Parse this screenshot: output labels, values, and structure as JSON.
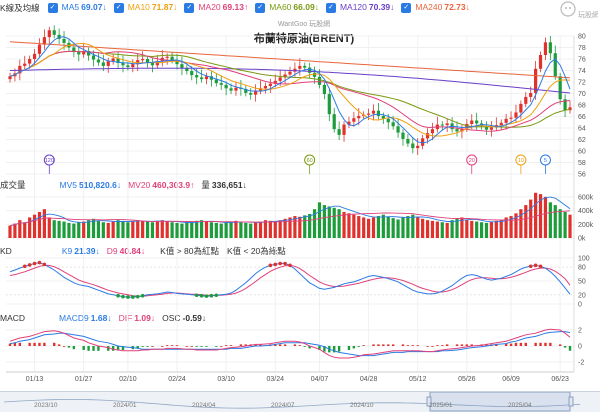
{
  "legend_main": {
    "label": "K線及均線",
    "items": [
      {
        "key": "MA5",
        "value": "69.07",
        "arrow": "↓",
        "color": "#2b7be4"
      },
      {
        "key": "MA10",
        "value": "71.87",
        "arrow": "↓",
        "color": "#f0a010"
      },
      {
        "key": "MA20",
        "value": "69.13",
        "arrow": "↑",
        "color": "#e0407a"
      },
      {
        "key": "MA60",
        "value": "66.09",
        "arrow": "↓",
        "color": "#7a9a10"
      },
      {
        "key": "MA120",
        "value": "70.39",
        "arrow": "↓",
        "color": "#6a3fc8"
      },
      {
        "key": "MA240",
        "value": "72.73",
        "arrow": "↓",
        "color": "#e8643c"
      }
    ]
  },
  "watermark": "WantGoo 玩股網",
  "chart_title": "布蘭特原油(BRENT)",
  "logo_text": "玩股網",
  "legend_volume": {
    "label": "成交量",
    "items": [
      {
        "key": "MV5",
        "value": "510,820.6",
        "arrow": "↓",
        "color": "#2b7be4"
      },
      {
        "key": "MV20",
        "value": "460,303.9",
        "arrow": "↑",
        "color": "#e0407a"
      },
      {
        "key": "量",
        "value": "336,651",
        "arrow": "↓",
        "color": "#333333"
      }
    ]
  },
  "legend_kd": {
    "label": "KD",
    "items": [
      {
        "key": "K9",
        "value": "21.39",
        "arrow": "↓",
        "color": "#2b7be4"
      },
      {
        "key": "D9",
        "value": "40.84",
        "arrow": "↓",
        "color": "#e0407a"
      }
    ],
    "notes": [
      "K值 > 80為紅點",
      "K值 < 20為綠點"
    ]
  },
  "legend_macd": {
    "label": "MACD",
    "items": [
      {
        "key": "MACD9",
        "value": "1.68",
        "arrow": "↓",
        "color": "#2b7be4"
      },
      {
        "key": "DIF",
        "value": "1.09",
        "arrow": "↓",
        "color": "#e0407a"
      },
      {
        "key": "OSC",
        "value": "-0.59",
        "arrow": "↓",
        "color": "#333333"
      }
    ]
  },
  "price_ticks": [
    "80",
    "78",
    "76",
    "74",
    "72",
    "70",
    "68",
    "66",
    "64",
    "62",
    "60",
    "58",
    "56"
  ],
  "volume_ticks": [
    "600k",
    "400k",
    "200k",
    "0k"
  ],
  "kd_ticks": [
    "100",
    "80",
    "50",
    "20",
    "0"
  ],
  "macd_ticks": [
    "2",
    "0",
    "-2"
  ],
  "x_ticks": [
    "01/13",
    "01/27",
    "02/10",
    "02/24",
    "03/10",
    "03/24",
    "04/07",
    "04/28",
    "05/12",
    "05/26",
    "06/09",
    "06/23"
  ],
  "nav_ticks": [
    "2023/10",
    "2024/01",
    "2024/04",
    "2024/07",
    "2024/10",
    "2025/01",
    "2025/04"
  ],
  "period_badges": [
    "120",
    "60",
    "20",
    "10",
    "5"
  ],
  "chart_data": {
    "type": "candlestick",
    "title": "布蘭特原油(BRENT)",
    "ylim": [
      56,
      80
    ],
    "ohlc_close": [
      73.0,
      73.5,
      74.8,
      75.2,
      76.0,
      76.9,
      78.5,
      79.8,
      81.0,
      80.2,
      79.5,
      78.8,
      78.0,
      77.2,
      76.8,
      77.4,
      76.6,
      75.9,
      75.4,
      74.8,
      75.6,
      76.1,
      75.3,
      74.9,
      74.6,
      75.1,
      75.8,
      76.0,
      75.4,
      74.9,
      75.6,
      76.2,
      76.4,
      75.8,
      75.1,
      74.4,
      73.9,
      73.2,
      72.8,
      72.5,
      73.0,
      72.4,
      71.8,
      71.5,
      70.9,
      70.5,
      71.0,
      70.8,
      70.1,
      69.8,
      70.5,
      70.9,
      71.3,
      71.7,
      72.2,
      72.8,
      73.3,
      73.8,
      74.3,
      74.8,
      74.5,
      73.6,
      72.9,
      71.5,
      69.9,
      66.4,
      63.8,
      62.8,
      64.6,
      65.1,
      65.7,
      66.1,
      66.3,
      66.5,
      67.0,
      66.1,
      65.6,
      65.0,
      64.3,
      63.2,
      62.1,
      61.3,
      60.5,
      60.9,
      62.2,
      63.1,
      63.8,
      64.6,
      64.5,
      64.8,
      63.8,
      63.4,
      63.9,
      64.7,
      65.3,
      64.8,
      64.3,
      63.7,
      64.1,
      64.5,
      64.9,
      65.6,
      65.8,
      66.7,
      68.2,
      69.4,
      70.1,
      74.3,
      76.7,
      78.9,
      77.0,
      73.0,
      69.0,
      67.1,
      67.6
    ],
    "ma_series": [
      {
        "name": "MA5",
        "value": "69.07"
      },
      {
        "name": "MA10",
        "value": "71.87"
      },
      {
        "name": "MA20",
        "value": "69.13"
      },
      {
        "name": "MA60",
        "value": "66.09"
      },
      {
        "name": "MA120",
        "value": "70.39"
      },
      {
        "name": "MA240",
        "value": "72.73"
      }
    ],
    "volume_k": [
      180,
      210,
      260,
      230,
      300,
      340,
      380,
      420,
      300,
      260,
      250,
      240,
      220,
      210,
      230,
      240,
      260,
      280,
      250,
      230,
      220,
      240,
      260,
      250,
      230,
      240,
      260,
      250,
      240,
      230,
      250,
      260,
      240,
      230,
      220,
      210,
      230,
      240,
      250,
      260,
      240,
      230,
      220,
      210,
      230,
      240,
      250,
      230,
      220,
      210,
      230,
      240,
      260,
      250,
      240,
      260,
      280,
      300,
      320,
      310,
      330,
      350,
      420,
      520,
      480,
      460,
      440,
      420,
      380,
      360,
      340,
      320,
      300,
      280,
      300,
      320,
      340,
      310,
      290,
      270,
      300,
      320,
      340,
      300,
      280,
      260,
      250,
      240,
      230,
      220,
      260,
      280,
      300,
      270,
      250,
      240,
      230,
      220,
      240,
      250,
      260,
      300,
      320,
      360,
      420,
      480,
      560,
      660,
      640,
      600,
      520,
      480,
      420,
      380,
      340
    ],
    "kd_k": [
      70,
      74,
      78,
      82,
      85,
      88,
      90,
      86,
      80,
      74,
      66,
      58,
      52,
      46,
      42,
      40,
      38,
      34,
      30,
      26,
      22,
      20,
      18,
      16,
      15,
      15,
      16,
      18,
      20,
      21,
      22,
      24,
      26,
      25,
      23,
      22,
      21,
      20,
      19,
      18,
      17,
      18,
      19,
      20,
      21,
      24,
      30,
      38,
      46,
      56,
      66,
      74,
      80,
      84,
      86,
      88,
      88,
      84,
      76,
      66,
      56,
      46,
      40,
      34,
      32,
      34,
      36,
      40,
      44,
      46,
      48,
      52,
      56,
      60,
      62,
      60,
      58,
      55,
      52,
      48,
      42,
      36,
      30,
      26,
      24,
      22,
      22,
      24,
      28,
      34,
      40,
      48,
      56,
      62,
      64,
      62,
      58,
      54,
      52,
      54,
      56,
      60,
      64,
      70,
      76,
      80,
      82,
      84,
      82,
      78,
      70,
      60,
      48,
      35,
      21.39
    ],
    "kd_d": [
      62,
      64,
      67,
      70,
      74,
      78,
      82,
      84,
      84,
      81,
      76,
      70,
      64,
      58,
      52,
      48,
      45,
      42,
      38,
      34,
      30,
      27,
      24,
      22,
      20,
      18,
      17,
      17,
      18,
      19,
      20,
      21,
      23,
      24,
      24,
      23,
      22,
      21,
      21,
      20,
      19,
      19,
      19,
      19,
      20,
      21,
      24,
      28,
      34,
      41,
      49,
      57,
      64,
      71,
      76,
      80,
      83,
      84,
      82,
      77,
      70,
      62,
      55,
      48,
      43,
      40,
      38,
      38,
      39,
      41,
      43,
      45,
      48,
      51,
      54,
      56,
      57,
      57,
      56,
      54,
      51,
      47,
      43,
      38,
      34,
      31,
      28,
      26,
      26,
      28,
      31,
      36,
      42,
      48,
      53,
      56,
      57,
      57,
      56,
      55,
      55,
      56,
      58,
      61,
      65,
      69,
      73,
      76,
      78,
      78,
      76,
      71,
      64,
      55,
      40.84
    ],
    "macd_dif": [
      0.6,
      0.8,
      1.0,
      1.2,
      1.4,
      1.6,
      1.8,
      1.9,
      1.8,
      1.6,
      1.3,
      1.0,
      0.7,
      0.4,
      0.2,
      0.0,
      -0.2,
      -0.4,
      -0.5,
      -0.6,
      -0.6,
      -0.6,
      -0.5,
      -0.5,
      -0.4,
      -0.4,
      -0.3,
      -0.3,
      -0.3,
      -0.4,
      -0.4,
      -0.5,
      -0.5,
      -0.5,
      -0.5,
      -0.4,
      -0.3,
      -0.2,
      -0.1,
      0.0,
      0.1,
      0.2,
      0.2,
      0.3,
      0.4,
      0.5,
      0.6,
      0.6,
      0.5,
      0.3,
      0.0,
      -0.4,
      -0.8,
      -1.2,
      -1.4,
      -1.5,
      -1.5,
      -1.4,
      -1.3,
      -1.1,
      -1.0,
      -0.9,
      -0.8,
      -0.7,
      -0.6,
      -0.6,
      -0.6,
      -0.6,
      -0.6,
      -0.7,
      -0.7,
      -0.6,
      -0.5,
      -0.4,
      -0.3,
      -0.2,
      -0.1,
      0.0,
      0.1,
      0.2,
      0.3,
      0.4,
      0.6,
      0.8,
      1.0,
      1.2,
      1.4,
      1.6,
      1.8,
      2.0,
      2.1,
      2.0,
      1.6,
      1.09
    ],
    "macd_signal": [
      0.3,
      0.4,
      0.6,
      0.8,
      1.0,
      1.2,
      1.4,
      1.5,
      1.6,
      1.6,
      1.5,
      1.4,
      1.2,
      1.0,
      0.8,
      0.6,
      0.4,
      0.2,
      0.0,
      -0.1,
      -0.2,
      -0.3,
      -0.4,
      -0.4,
      -0.4,
      -0.4,
      -0.4,
      -0.4,
      -0.4,
      -0.4,
      -0.4,
      -0.4,
      -0.4,
      -0.4,
      -0.4,
      -0.4,
      -0.4,
      -0.3,
      -0.3,
      -0.2,
      -0.1,
      0.0,
      0.0,
      0.1,
      0.2,
      0.3,
      0.4,
      0.4,
      0.4,
      0.4,
      0.3,
      0.1,
      -0.1,
      -0.4,
      -0.6,
      -0.8,
      -1.0,
      -1.1,
      -1.2,
      -1.2,
      -1.2,
      -1.1,
      -1.0,
      -0.9,
      -0.8,
      -0.8,
      -0.7,
      -0.7,
      -0.7,
      -0.7,
      -0.7,
      -0.7,
      -0.6,
      -0.6,
      -0.5,
      -0.4,
      -0.3,
      -0.2,
      -0.1,
      0.0,
      0.1,
      0.2,
      0.3,
      0.5,
      0.6,
      0.8,
      1.0,
      1.2,
      1.4,
      1.6,
      1.7,
      1.8,
      1.8,
      1.68
    ],
    "xlabel": "",
    "ylabel": ""
  }
}
